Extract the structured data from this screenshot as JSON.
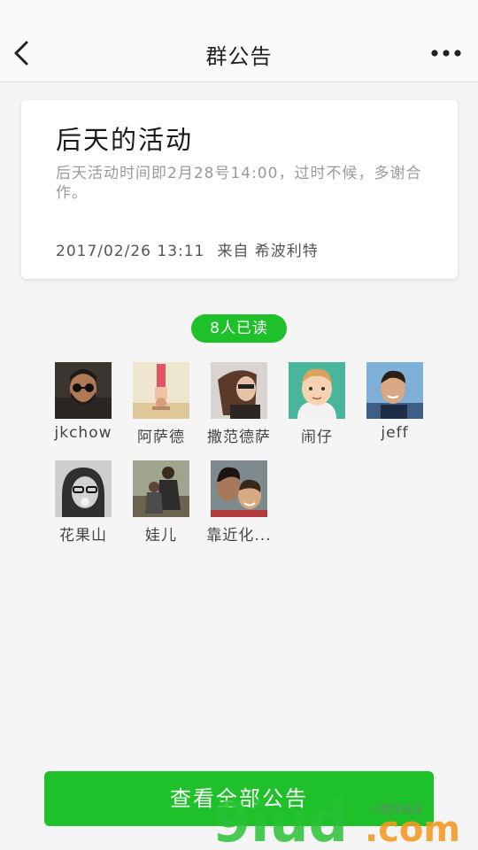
{
  "nav": {
    "back_icon": "chevron-left-icon",
    "title": "群公告",
    "more_icon": "more-dots-icon"
  },
  "announcement": {
    "title": "后天的活动",
    "body": "后天活动时间即2月28号14:00，过时不候，多谢合作。",
    "timestamp": "2017/02/26 13:11",
    "from_label": "来自",
    "author": "希波利特"
  },
  "read_badge": "8人已读",
  "readers": [
    {
      "name": "jkchow",
      "avatar": "man-sunglasses-beard"
    },
    {
      "name": "阿萨德",
      "avatar": "person-handstand"
    },
    {
      "name": "撒范德萨",
      "avatar": "woman-long-hair"
    },
    {
      "name": "闹仔",
      "avatar": "cartoon-boy"
    },
    {
      "name": "jeff",
      "avatar": "man-smiling"
    },
    {
      "name": "花果山",
      "avatar": "woman-glasses-bw"
    },
    {
      "name": "娃儿",
      "avatar": "couple-sitting"
    },
    {
      "name": "靠近化...",
      "avatar": "selfie-kids"
    }
  ],
  "view_all_button": "查看全部公告",
  "watermark": {
    "text": "9iud.com",
    "tagline": "小程序商店"
  },
  "colors": {
    "accent": "#1fc12b",
    "background": "#f5f5f5",
    "watermark_green": "#29c235",
    "watermark_orange": "#f39a26"
  }
}
